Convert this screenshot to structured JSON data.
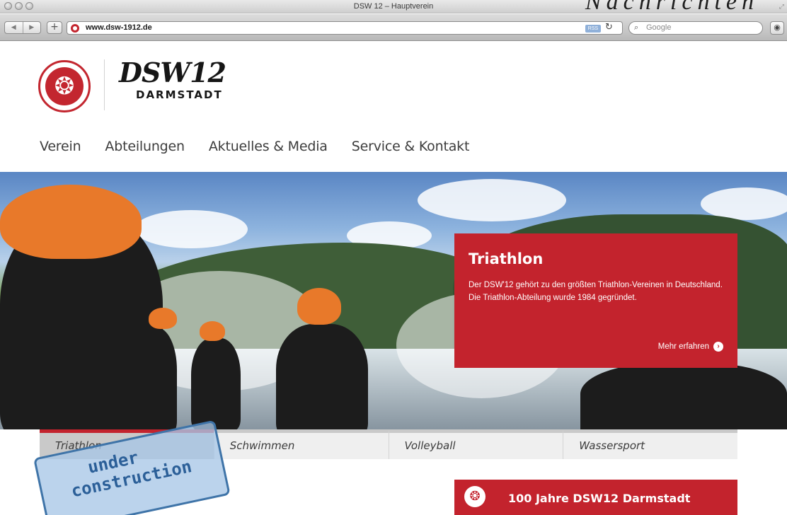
{
  "browser": {
    "window_title": "DSW 12 – Hauptverein",
    "corner_text": "Nachrichten",
    "url": "www.dsw-1912.de",
    "rss_label": "RSS",
    "search_placeholder": "Google"
  },
  "site": {
    "logo_mark": "DSW12",
    "logo_city": "DARMSTADT",
    "nav": [
      "Verein",
      "Abteilungen",
      "Aktuelles & Media",
      "Service & Kontakt"
    ]
  },
  "hero": {
    "title": "Triathlon",
    "text": "Der DSW'12 gehört zu den größten Triathlon-Vereinen in Deutschland. Die Triathlon-Abteilung wurde 1984 gegründet.",
    "more_label": "Mehr erfahren"
  },
  "tabs": [
    {
      "label": "Triathlon",
      "active": true
    },
    {
      "label": "Schwimmen",
      "active": false
    },
    {
      "label": "Volleyball",
      "active": false
    },
    {
      "label": "Wassersport",
      "active": false
    }
  ],
  "promo": {
    "title": "100 Jahre DSW12 Darmstadt"
  },
  "stamp": {
    "line1": "under",
    "line2": "construction"
  },
  "colors": {
    "brand_red": "#c3232d",
    "tab_grey": "#efefef",
    "tab_active_grey": "#c9c9c9"
  },
  "icons": [
    "back-icon",
    "forward-icon",
    "add-tab-icon",
    "favicon",
    "reload-icon",
    "search-icon",
    "bookmark-icon",
    "club-crest-icon",
    "arrow-right-circle-icon"
  ]
}
